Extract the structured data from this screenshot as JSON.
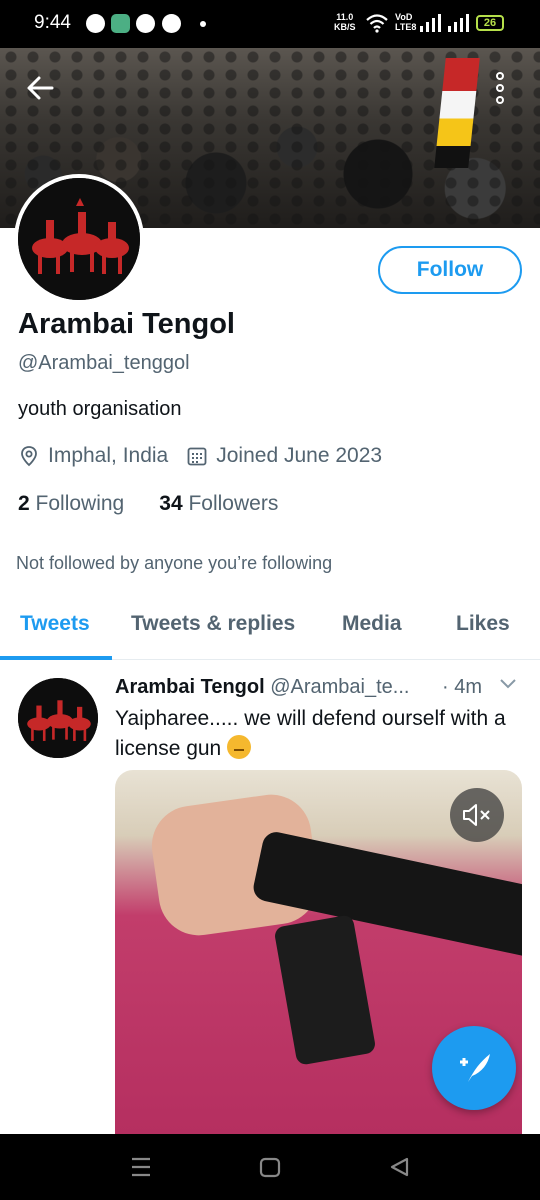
{
  "status_bar": {
    "time": "9:44",
    "speed_value": "11.0",
    "speed_unit": "KB/S",
    "volte_top": "VoD",
    "volte_bottom": "LTE8",
    "battery": "26"
  },
  "profile": {
    "name": "Arambai Tengol",
    "handle": "@Arambai_tenggol",
    "bio": "youth organisation",
    "location": "Imphal, India",
    "joined": "Joined June 2023",
    "following_count": "2",
    "following_label": "Following",
    "followers_count": "34",
    "followers_label": "Followers",
    "not_followed_text": "Not followed by anyone you’re following",
    "follow_button": "Follow"
  },
  "tabs": [
    {
      "label": "Tweets",
      "active": true
    },
    {
      "label": "Tweets & replies",
      "active": false
    },
    {
      "label": "Media",
      "active": false
    },
    {
      "label": "Likes",
      "active": false
    }
  ],
  "tweet": {
    "author_name": "Arambai Tengol",
    "author_handle": "@Arambai_te...",
    "time": "· 4m",
    "text": "Yaipharee..... we will defend ourself with a license gun"
  },
  "colors": {
    "accent": "#1d9bf0",
    "secondary_text": "#536471",
    "primary_text": "#0f1419"
  },
  "icons": {
    "back": "arrow-left-icon",
    "more": "more-vertical-icon",
    "location": "location-pin-icon",
    "calendar": "calendar-icon",
    "chevron": "chevron-down-icon",
    "mute": "volume-muted-icon",
    "compose": "compose-tweet-icon"
  }
}
